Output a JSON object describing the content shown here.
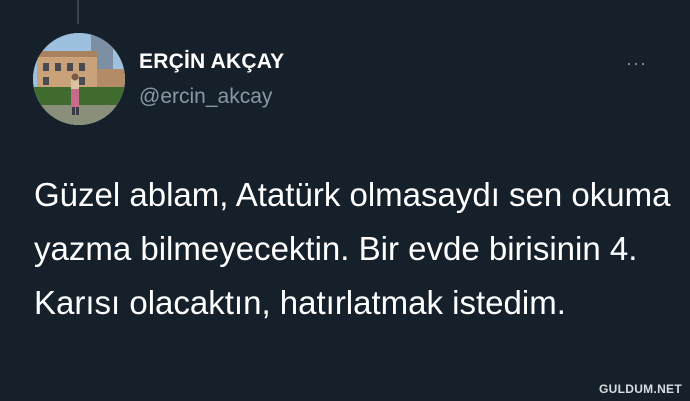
{
  "tweet": {
    "author_name": "ERÇİN AKÇAY",
    "author_handle": "@ercin_akcay",
    "more_menu": "···",
    "text": "Güzel ablam, Atatürk olmasaydı sen okuma yazma bilmeyecektin. Bir evde birisinin 4. Karısı olacaktın, hatırlatmak istedim."
  },
  "watermark": "GULDUM.NET",
  "colors": {
    "background": "#15202b",
    "text": "#ffffff",
    "secondary_text": "#8899a6"
  }
}
